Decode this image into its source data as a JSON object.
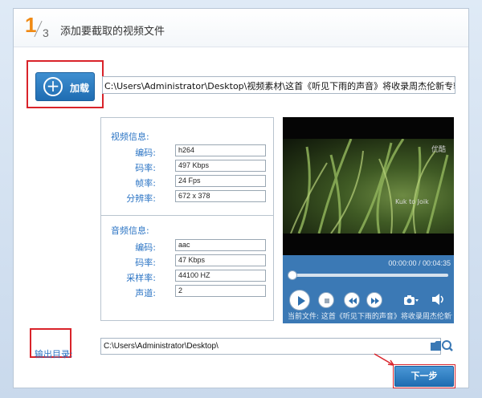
{
  "header": {
    "step_current": "1",
    "step_total": "3",
    "title": "添加要截取的视频文件"
  },
  "load": {
    "label": "加载",
    "file_path": "C:\\Users\\Administrator\\Desktop\\视频素材\\这首《听见下雨的声音》将收录周杰伦新专辑"
  },
  "video_info": {
    "title": "视频信息:",
    "fields": [
      {
        "label": "编码:",
        "value": "h264"
      },
      {
        "label": "码率:",
        "value": "497 Kbps"
      },
      {
        "label": "帧率:",
        "value": "24 Fps"
      },
      {
        "label": "分辨率:",
        "value": "672 x 378"
      }
    ]
  },
  "audio_info": {
    "title": "音频信息:",
    "fields": [
      {
        "label": "编码:",
        "value": "aac"
      },
      {
        "label": "码率:",
        "value": "47 Kbps"
      },
      {
        "label": "采样率:",
        "value": "44100 HZ"
      },
      {
        "label": "声道:",
        "value": "2"
      }
    ]
  },
  "player": {
    "watermark": "优酷",
    "subtitle_mark": "Kuk to Joik",
    "time": "00:00:00 / 00:04:35",
    "progress": 0,
    "now_playing": "当前文件: 这首《听见下雨的声音》将收录周杰伦新专辑"
  },
  "output": {
    "label": "输出目录:",
    "path": "C:\\Users\\Administrator\\Desktop\\"
  },
  "next_button": {
    "label": "下一步"
  },
  "colors": {
    "accent_blue": "#2b74c4",
    "step_orange": "#f08a14",
    "highlight_red": "#d9232a"
  }
}
